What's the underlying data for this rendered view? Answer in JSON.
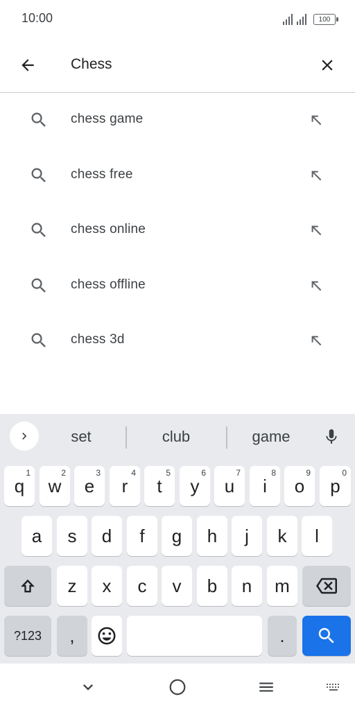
{
  "status_bar": {
    "time": "10:00",
    "battery": "100"
  },
  "search": {
    "query": "Chess",
    "back_icon": "arrow-left-icon",
    "clear_icon": "close-icon"
  },
  "suggestions": [
    {
      "label": "chess game"
    },
    {
      "label": "chess free"
    },
    {
      "label": "chess online"
    },
    {
      "label": "chess offline"
    },
    {
      "label": "chess 3d"
    }
  ],
  "keyboard": {
    "word_suggestions": [
      "set",
      "club",
      "game"
    ],
    "row1": [
      {
        "key": "q",
        "hint": "1"
      },
      {
        "key": "w",
        "hint": "2"
      },
      {
        "key": "e",
        "hint": "3"
      },
      {
        "key": "r",
        "hint": "4"
      },
      {
        "key": "t",
        "hint": "5"
      },
      {
        "key": "y",
        "hint": "6"
      },
      {
        "key": "u",
        "hint": "7"
      },
      {
        "key": "i",
        "hint": "8"
      },
      {
        "key": "o",
        "hint": "9"
      },
      {
        "key": "p",
        "hint": "0"
      }
    ],
    "row2": [
      "a",
      "s",
      "d",
      "f",
      "g",
      "h",
      "j",
      "k",
      "l"
    ],
    "row3": [
      "z",
      "x",
      "c",
      "v",
      "b",
      "n",
      "m"
    ],
    "symbols_label": "?123",
    "comma_label": ",",
    "period_label": ".",
    "accent_color": "#1a73e8"
  }
}
